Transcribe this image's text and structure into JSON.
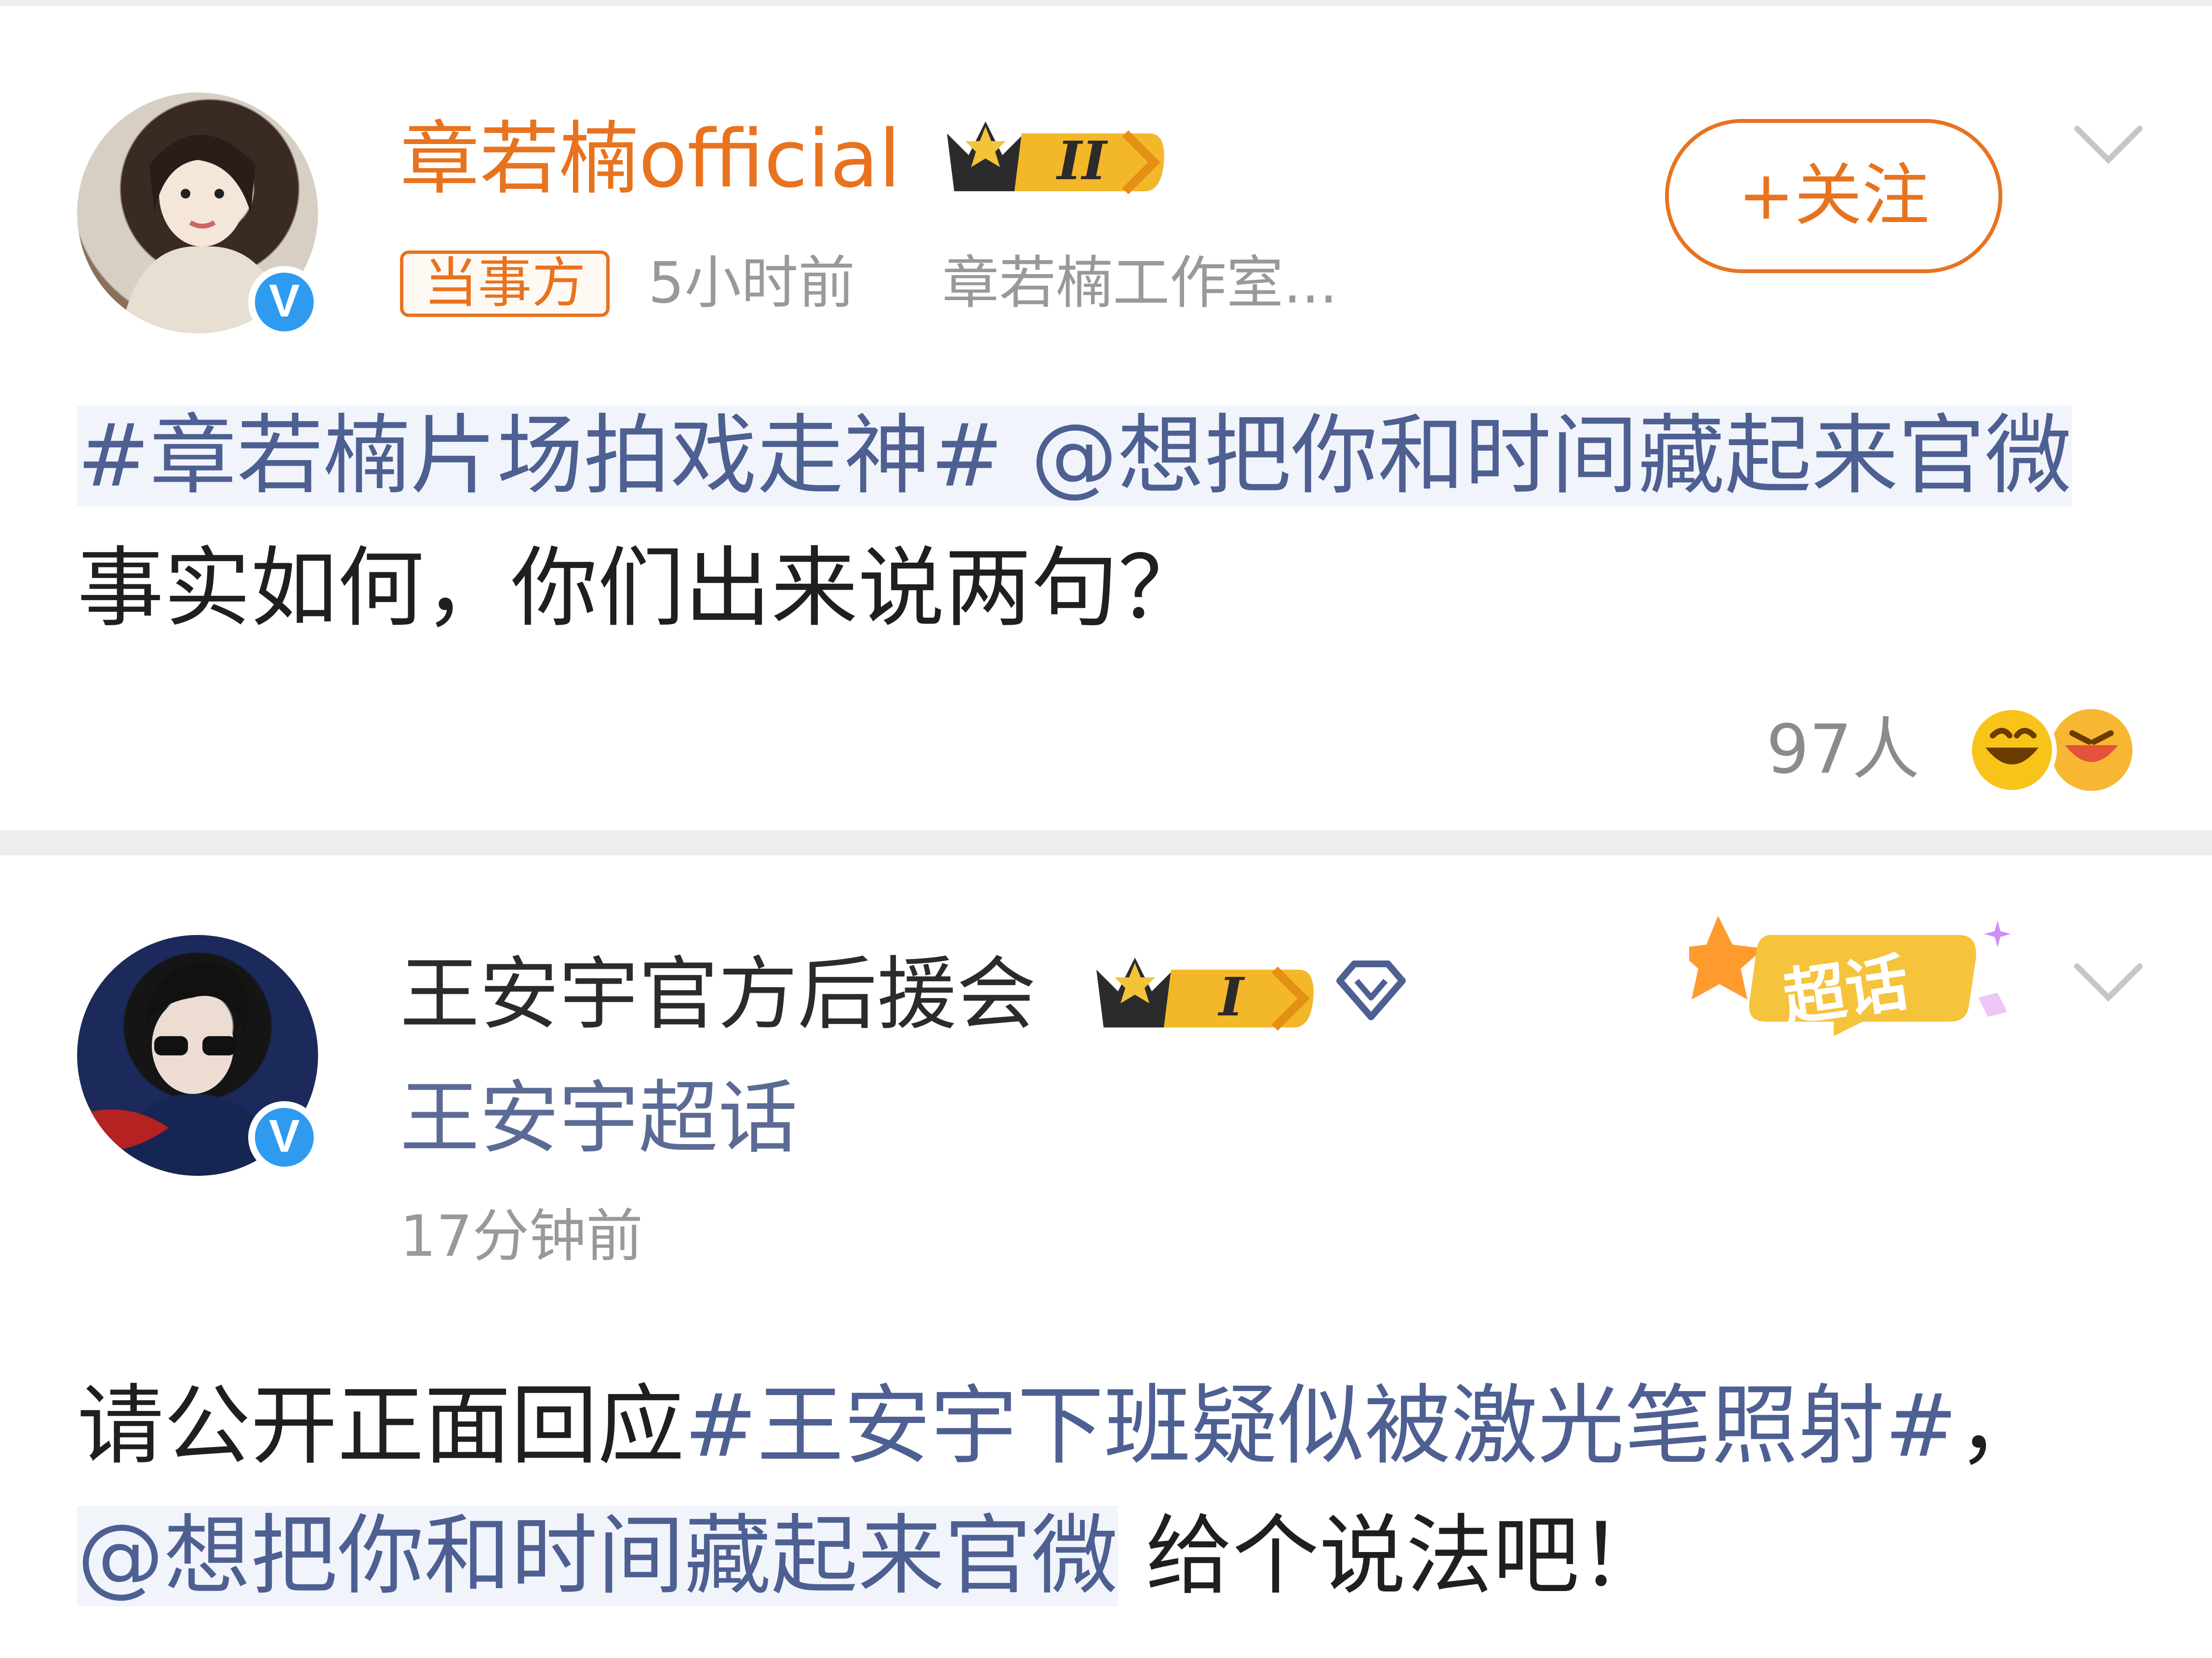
{
  "posts": [
    {
      "author": "章若楠official",
      "level_badge": "II",
      "party_badge": "当事方",
      "time": "5小时前",
      "source": "章若楠工作室...",
      "follow_button": "+关注",
      "text_segments": [
        "#章若楠片场拍戏走神#",
        " @想把你和时间藏起来官微",
        "事实如何，你们出来说两句？"
      ],
      "reactions_count": "97人"
    },
    {
      "author": "王安宇官方后援会",
      "level_badge": "I",
      "supertopic_link": "王安宇超话",
      "supertopic_badge": "超话",
      "time": "17分钟前",
      "text_segments": [
        "请公开正面回应",
        "#王安宇下班疑似被激光笔照射#",
        "，",
        "@想把你和时间藏起来官微",
        " 给个说法吧！"
      ]
    }
  ],
  "colors": {
    "orange": "#e8731f",
    "link": "#4e5f92",
    "gray": "#999999",
    "verified": "#2e9bf0"
  },
  "icons": [
    "chevron-down-icon",
    "crown-badge-icon",
    "diamond-icon",
    "verified-icon",
    "laugh-emoji-icon"
  ]
}
